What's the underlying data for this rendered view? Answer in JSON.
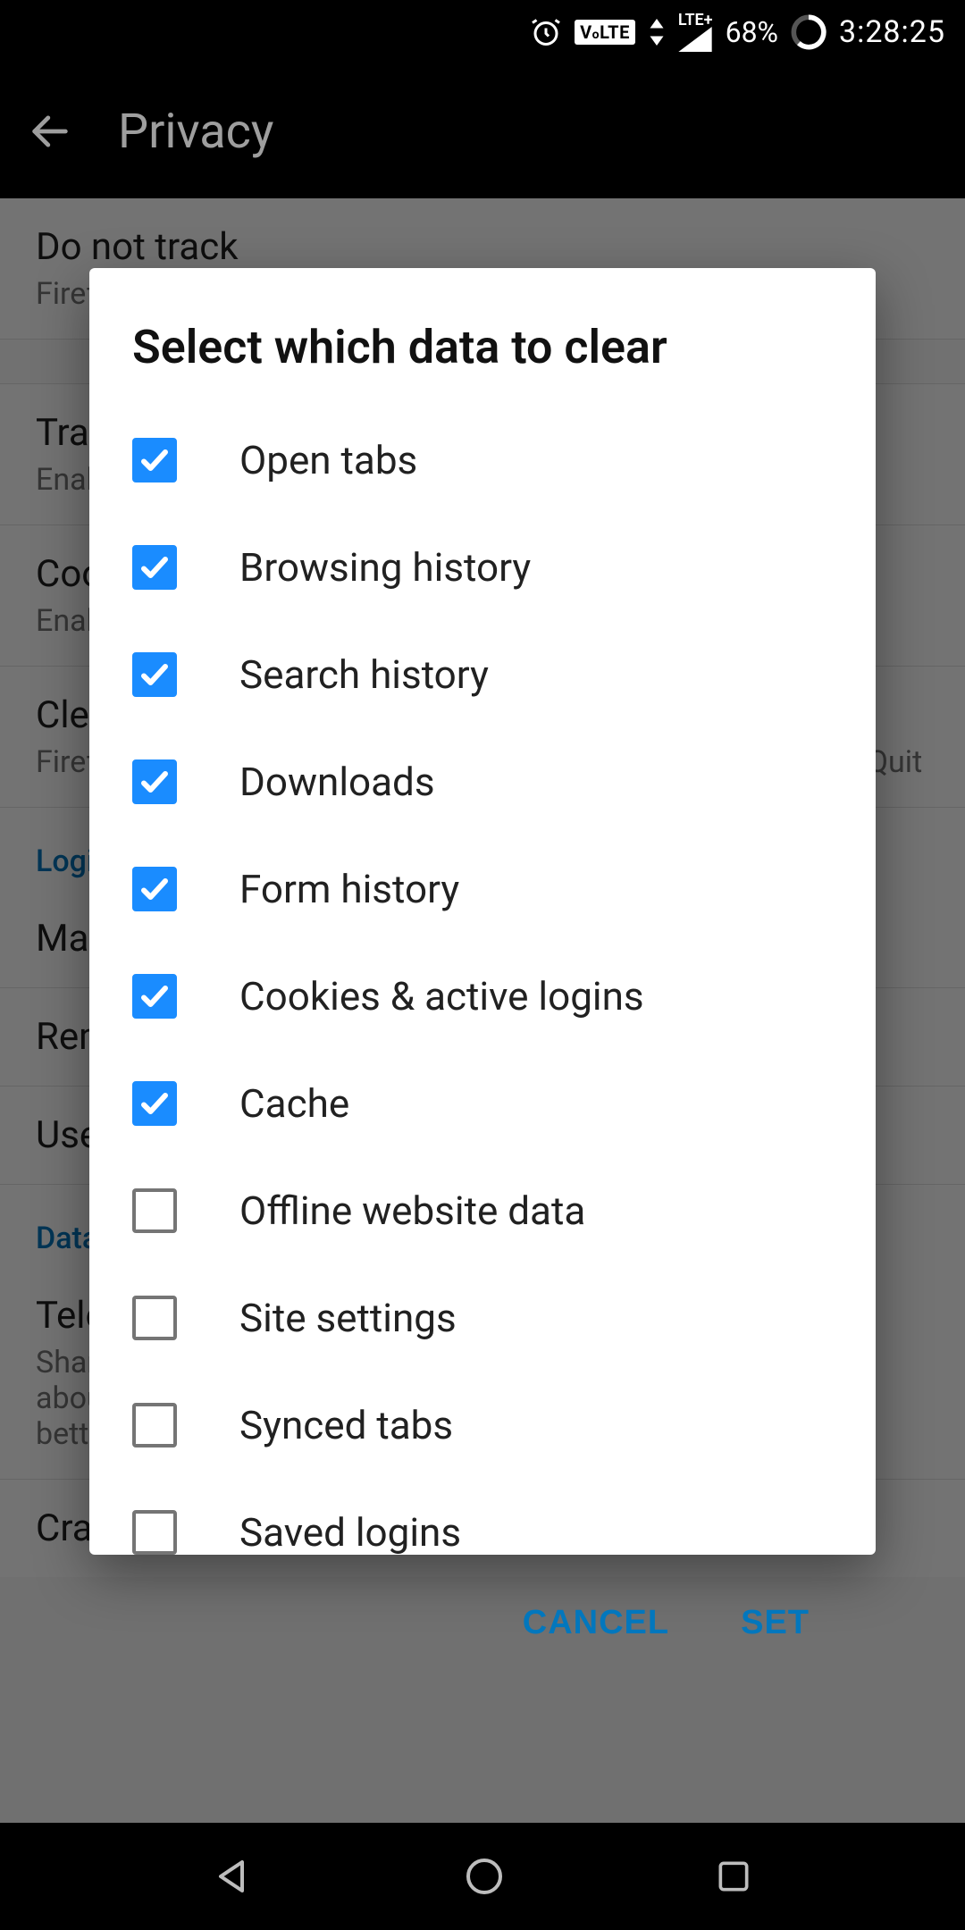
{
  "status_bar": {
    "volte": "V LTE",
    "lte": "LTE+",
    "battery": "68%",
    "time": "3:28:25"
  },
  "app_bar": {
    "title": "Privacy"
  },
  "bg": {
    "items": [
      {
        "primary": "Do not track",
        "secondary": "Firefox will tell sites that you do not want to be tracked"
      },
      {
        "primary": "Tracking protection",
        "secondary": "Enabled"
      },
      {
        "primary": "Cookies",
        "secondary": "Enabled"
      },
      {
        "primary": "Clear private data on exit",
        "secondary": "Firefox will automatically clear your data whenever you select Quit"
      }
    ],
    "header1": "Logins",
    "items2": [
      {
        "primary": "Manage logins",
        "secondary": ""
      },
      {
        "primary": "Remember logins",
        "secondary": ""
      },
      {
        "primary": "Use master password",
        "secondary": ""
      }
    ],
    "header2": "Data choices",
    "items3": [
      {
        "primary": "Telemetry",
        "secondary": "Shares performance, usage, hardware and customization data about your browser with Mozilla to help us make Firefox Beta better"
      },
      {
        "primary": "Crash Reporter",
        "secondary": ""
      }
    ]
  },
  "dialog": {
    "title": "Select which data to clear",
    "options": [
      {
        "label": "Open tabs",
        "checked": true
      },
      {
        "label": "Browsing history",
        "checked": true
      },
      {
        "label": "Search history",
        "checked": true
      },
      {
        "label": "Downloads",
        "checked": true
      },
      {
        "label": "Form history",
        "checked": true
      },
      {
        "label": "Cookies & active logins",
        "checked": true
      },
      {
        "label": "Cache",
        "checked": true
      },
      {
        "label": "Offline website data",
        "checked": false
      },
      {
        "label": "Site settings",
        "checked": false
      },
      {
        "label": "Synced tabs",
        "checked": false
      },
      {
        "label": "Saved logins",
        "checked": false
      }
    ],
    "cancel": "CANCEL",
    "set": "SET"
  }
}
